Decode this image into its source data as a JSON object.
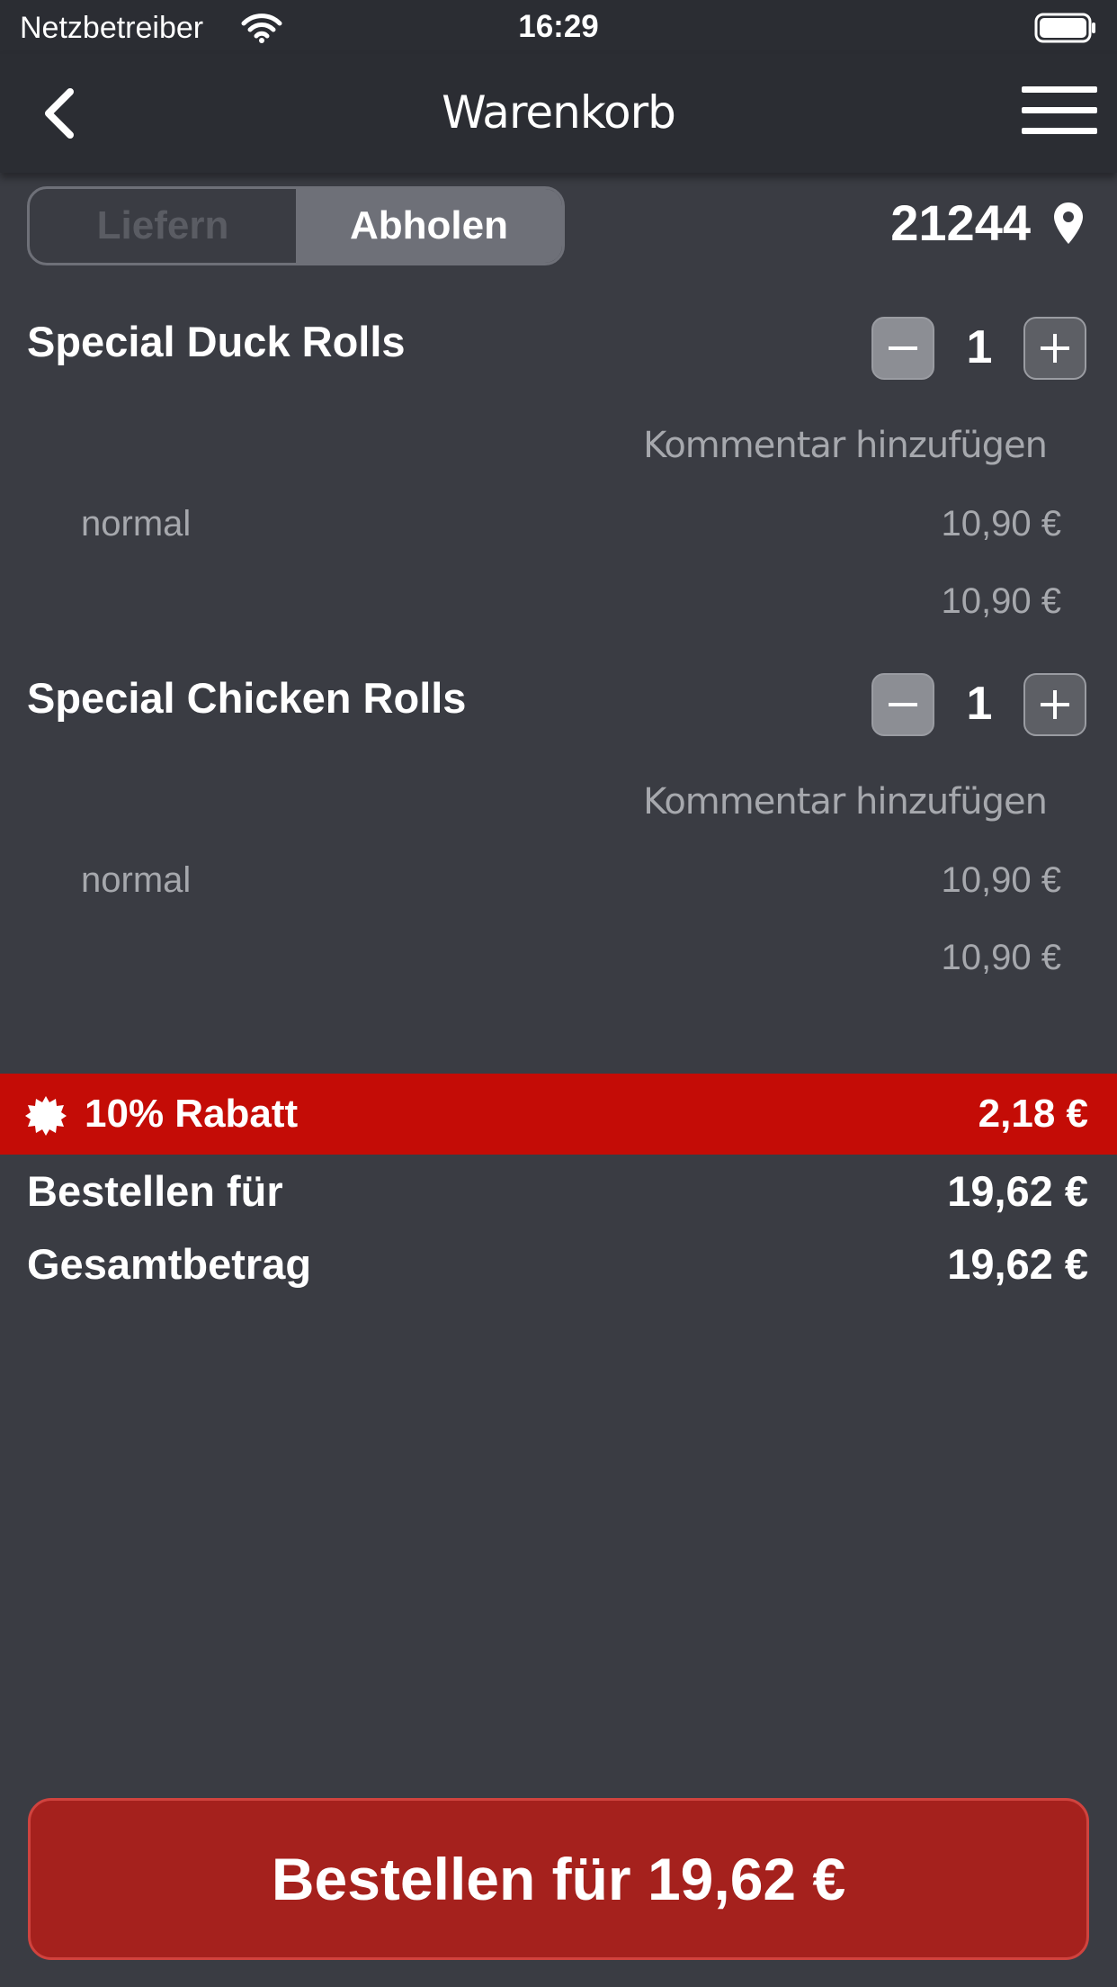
{
  "status": {
    "carrier": "Netzbetreiber",
    "time": "16:29"
  },
  "nav": {
    "title": "Warenkorb"
  },
  "segmented": {
    "deliver": "Liefern",
    "pickup": "Abholen",
    "selected": "Abholen"
  },
  "location": {
    "zip": "21244"
  },
  "items": [
    {
      "name": "Special Duck Rolls",
      "quantity": "1",
      "comment_label": "Kommentar hinzufügen",
      "variant": "normal",
      "variant_price": "10,90 €",
      "line_total": "10,90 €"
    },
    {
      "name": "Special Chicken Rolls",
      "quantity": "1",
      "comment_label": "Kommentar hinzufügen",
      "variant": "normal",
      "variant_price": "10,90 €",
      "line_total": "10,90 €"
    }
  ],
  "discount": {
    "label": "10% Rabatt",
    "amount": "2,18 €"
  },
  "summary": {
    "order_for_label": "Bestellen für",
    "order_for_value": "19,62 €",
    "total_label": "Gesamtbetrag",
    "total_value": "19,62 €"
  },
  "order_button": {
    "label": "Bestellen für 19,62 €"
  },
  "colors": {
    "background": "#3a3c43",
    "navbar": "#2b2d33",
    "discount": "#c40c06",
    "order_button": "#a5211d"
  }
}
